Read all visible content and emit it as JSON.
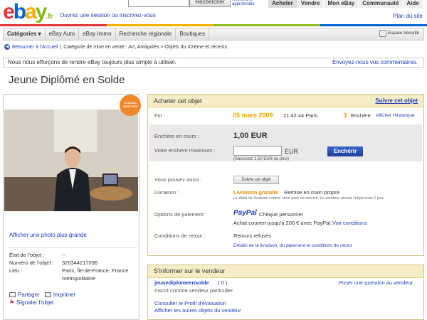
{
  "header": {
    "logo_letters": [
      "e",
      "b",
      "a",
      "y"
    ],
    "logo_colors": [
      "#e53238",
      "#0064d2",
      "#f5af02",
      "#86b817"
    ],
    "logo_suffix": ".fr",
    "signin_text": "Ouvrez une session ou inscrivez-vous",
    "search_placeholder": "",
    "search_button": "Rechercher",
    "advanced_search": "Recherche approfondie",
    "nav": [
      "Acheter",
      "Vendre",
      "Mon eBay",
      "Communauté",
      "Aide"
    ],
    "nav_active": "Acheter",
    "site_map": "Plan du site"
  },
  "menu": {
    "tabs": [
      "Catégories ▾",
      "eBay Auto",
      "eBay Immo",
      "Recherche régionale",
      "Boutiques"
    ],
    "security": "Espace Sécurité"
  },
  "breadcrumb": {
    "back": "Retourner à l'Accueil",
    "path": "Catégorie de mise en vente : Art, Antiquités > Objets du XXème et récents"
  },
  "notice": {
    "text": "Nous nous efforçons de rendre eBay toujours plus simple à utiliser.",
    "feedback": "Envoyez-nous vos commentaires."
  },
  "item": {
    "title": "Jeune Diplômé en Solde",
    "badge": "Livraison GRATUITE",
    "more_photo": "Afficher une photo plus grande",
    "details": [
      {
        "k": "Etat de l'objet :",
        "v": "--"
      },
      {
        "k": "Numéro de l'objet :",
        "v": "320344217096"
      },
      {
        "k": "Lieu :",
        "v": "Paris, Île-de-France, France métropolitaine"
      }
    ],
    "actions": {
      "share": "Partager",
      "print": "Imprimer",
      "report": "Signaler l'objet"
    }
  },
  "buy": {
    "heading": "Acheter cet objet",
    "follow": "Suivre cet objet",
    "end_label": "Fin :",
    "end_date": "05 mars 2009",
    "end_time": "21:42:44 Paris",
    "bids_count": "1",
    "bids_label": "Enchère",
    "history": "Afficher l'historique",
    "current_label": "Enchère en cours :",
    "current_value": "1,00 EUR",
    "max_label": "Votre enchère maximum :",
    "currency": "EUR",
    "min_hint": "(Saisissez 1,50 EUR ou plus)",
    "bid_button": "Enchérir",
    "also_label": "Vous pouvez aussi :",
    "follow_button": "Suivre cet objet",
    "delivery_label": "Livraison :",
    "delivery_free": "Livraison gratuite",
    "delivery_hand": "Remise en main propre",
    "delivery_note": "Le délai de livraison estimé varie pour ce service. Le vendeur envoie l'objet sous 1 jour.",
    "payment_label": "Options de paiement :",
    "paypal": "PayPal",
    "check": "Chèque personnel",
    "paypal_cover": "Achat couvert jusqu'à 200 € avec PayPal.",
    "see_terms": "Voir conditions",
    "return_label": "Conditions de retour :",
    "return_value": "Retours refusés",
    "details_link": "Détails de la livraison, du paiement et conditions de retour"
  },
  "seller": {
    "heading": "S'informer sur le vendeur",
    "name": "jeunediplomeensolde",
    "score": "( 0 )",
    "ask": "Poser une question au vendeur",
    "since": "Inscrit comme vendeur particulier",
    "profile": "Consulter le Profil d'évaluation",
    "other_items": "Afficher les autres objets du vendeur"
  },
  "colors": {
    "accent_orange": "#f5a000",
    "link_blue": "#1f3fb8",
    "free_delivery": "#e68a00",
    "box_header": "#f6edc6",
    "colorbar": [
      "#e53238",
      "#f5af02",
      "#86b817",
      "#0064d2"
    ]
  }
}
